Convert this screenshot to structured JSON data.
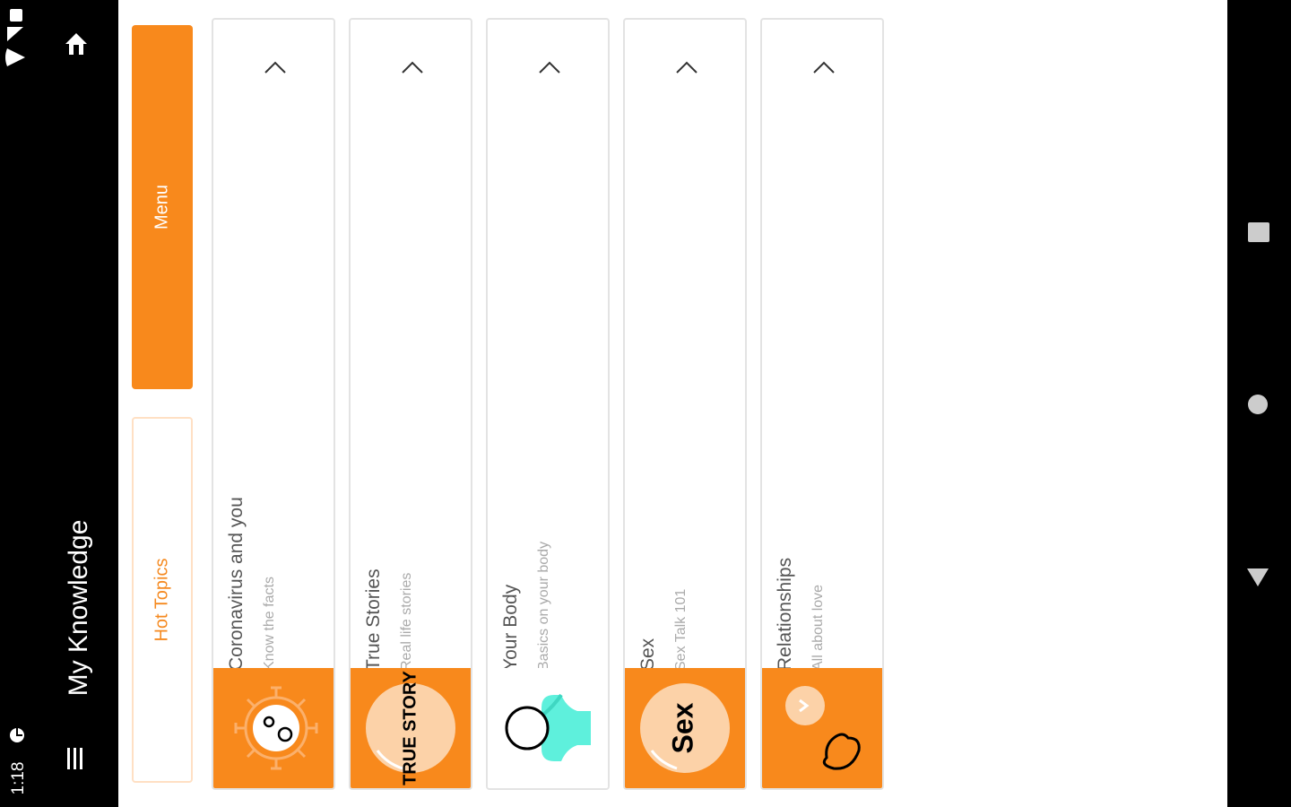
{
  "status_bar": {
    "time": "1:18",
    "icons": [
      "notification-icon",
      "wifi-icon",
      "signal-icon",
      "battery-icon"
    ]
  },
  "app_bar": {
    "title": "My Knowledge",
    "menu_icon": "hamburger-icon",
    "home_icon": "home-icon"
  },
  "tabs": {
    "hot_topics": "Hot Topics",
    "menu": "Menu"
  },
  "cards": [
    {
      "title": "Coronavirus and you",
      "subtitle": "Know the facts",
      "image": "virus-icon",
      "image_bg": "orange"
    },
    {
      "title": "True Stories",
      "subtitle": "Real life stories",
      "image": "true-story-badge",
      "image_text": "TRUE STORY",
      "image_bg": "orange"
    },
    {
      "title": "Your Body",
      "subtitle": "Basics on your body",
      "image": "body-icon",
      "image_bg": "white"
    },
    {
      "title": "Sex",
      "subtitle": "Sex Talk 101",
      "image": "sex-badge",
      "image_text": "Sex",
      "image_bg": "orange"
    },
    {
      "title": "Relationships",
      "subtitle": "All about love",
      "image": "heart-icon",
      "image_bg": "orange"
    }
  ],
  "nav_bar": {
    "icons": [
      "recents-icon",
      "home-circle-icon",
      "back-icon"
    ]
  },
  "colors": {
    "accent": "#f8891c",
    "accent_light": "#ffe0c4",
    "teal": "#5ef0dc",
    "background": "#ffffff",
    "chrome": "#000000"
  }
}
